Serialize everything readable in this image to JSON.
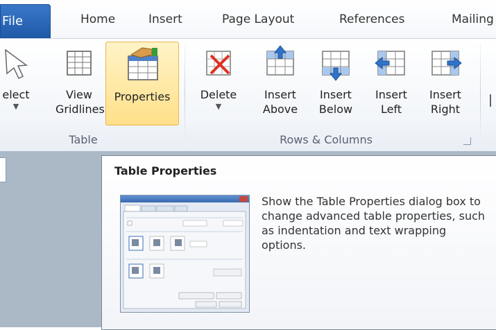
{
  "tabs": [
    {
      "label": "File"
    },
    {
      "label": "Home"
    },
    {
      "label": "Insert"
    },
    {
      "label": "Page Layout"
    },
    {
      "label": "References"
    },
    {
      "label": "Mailing"
    }
  ],
  "ribbon": {
    "table_group": {
      "label": "Table",
      "buttons": {
        "select": {
          "label": "elect"
        },
        "view_gridlines": {
          "line1": "View",
          "line2": "Gridlines"
        },
        "properties": {
          "label": "Properties"
        }
      }
    },
    "rows_columns_group": {
      "label": "Rows & Columns",
      "buttons": {
        "delete": {
          "label": "Delete"
        },
        "insert_above": {
          "line1": "Insert",
          "line2": "Above"
        },
        "insert_below": {
          "line1": "Insert",
          "line2": "Below"
        },
        "insert_left": {
          "line1": "Insert",
          "line2": "Left"
        },
        "insert_right": {
          "line1": "Insert",
          "line2": "Right"
        }
      }
    }
  },
  "tooltip": {
    "title": "Table Properties",
    "description": "Show the Table Properties dialog box to change advanced table properties, such as indentation and text wrapping options."
  },
  "colors": {
    "file_tab": "#1f5aa8",
    "active_button": "#ffe08a",
    "document_background": "#abb8c6"
  }
}
